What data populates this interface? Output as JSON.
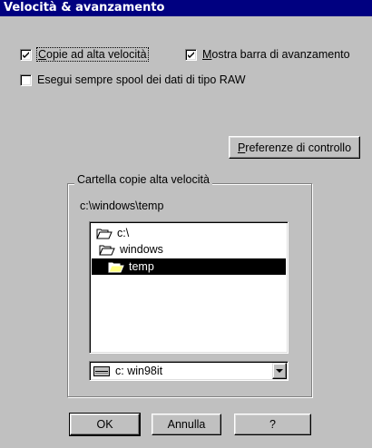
{
  "window": {
    "title": "Velocità & avanzamento"
  },
  "options": {
    "fast_copy": {
      "pre": "",
      "key": "C",
      "post": "opie ad alta velocità",
      "checked": true
    },
    "progress_bar": {
      "pre": "",
      "key": "M",
      "post": "ostra barra di avanzamento",
      "checked": true
    },
    "always_spool": {
      "label": "Esegui sempre spool dei dati di tipo RAW",
      "checked": false
    }
  },
  "monitor_prefs_button": {
    "key": "P",
    "rest": "referenze di controllo"
  },
  "fast_copy_folder": {
    "group_label": "Cartella copie alta velocità",
    "path": "c:\\windows\\temp",
    "tree": [
      {
        "label": "c:\\",
        "icon": "open-folder-icon",
        "selected": false
      },
      {
        "label": "windows",
        "icon": "open-folder-icon",
        "selected": false
      },
      {
        "label": "temp",
        "icon": "open-folder-icon",
        "selected": true
      }
    ],
    "drive": {
      "icon": "drive-icon",
      "label": "c:  win98it"
    }
  },
  "buttons": {
    "ok": "OK",
    "cancel": "Annulla",
    "help": "?"
  }
}
